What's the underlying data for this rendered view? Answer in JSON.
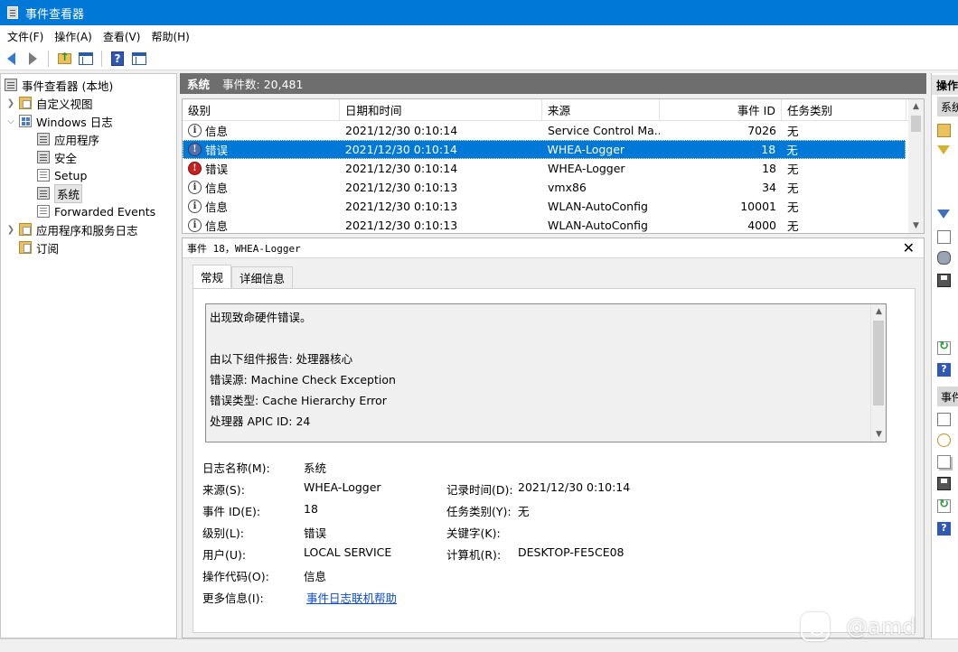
{
  "window": {
    "title": "事件查看器"
  },
  "menu": [
    "文件(F)",
    "操作(A)",
    "查看(V)",
    "帮助(H)"
  ],
  "toolbar": {
    "icons": [
      "back-arrow-icon",
      "forward-arrow-icon",
      "folder-up-icon",
      "show-hide-tree-icon",
      "help-icon",
      "show-hide-action-pane-icon"
    ]
  },
  "tree": {
    "root": "事件查看器 (本地)",
    "custom_views": "自定义视图",
    "windows_logs": "Windows 日志",
    "logs": [
      "应用程序",
      "安全",
      "Setup",
      "系统",
      "Forwarded Events"
    ],
    "app_service_logs": "应用程序和服务日志",
    "subscriptions": "订阅"
  },
  "main_header": {
    "name": "系统",
    "count": "事件数: 20,481"
  },
  "event_table": {
    "columns": [
      "级别",
      "日期和时间",
      "来源",
      "事件 ID",
      "任务类别"
    ],
    "rows": [
      {
        "level": "信息",
        "type": "info",
        "date": "2021/12/30 0:10:14",
        "source": "Service Control Ma...",
        "id": "7026",
        "category": "无"
      },
      {
        "level": "错误",
        "type": "error",
        "date": "2021/12/30 0:10:14",
        "source": "WHEA-Logger",
        "id": "18",
        "category": "无",
        "selected": true
      },
      {
        "level": "错误",
        "type": "error",
        "date": "2021/12/30 0:10:14",
        "source": "WHEA-Logger",
        "id": "18",
        "category": "无"
      },
      {
        "level": "信息",
        "type": "info",
        "date": "2021/12/30 0:10:13",
        "source": "vmx86",
        "id": "34",
        "category": "无"
      },
      {
        "level": "信息",
        "type": "info",
        "date": "2021/12/30 0:10:13",
        "source": "WLAN-AutoConfig",
        "id": "10001",
        "category": "无"
      },
      {
        "level": "信息",
        "type": "info",
        "date": "2021/12/30 0:10:13",
        "source": "WLAN-AutoConfig",
        "id": "4000",
        "category": "无"
      }
    ]
  },
  "detail": {
    "title": "事件 18，WHEA-Logger",
    "tabs": [
      "常规",
      "详细信息"
    ],
    "message": [
      "出现致命硬件错误。",
      "",
      "由以下组件报告: 处理器核心",
      "错误源: Machine Check Exception",
      "错误类型: Cache Hierarchy Error",
      "处理器 APIC ID: 24"
    ],
    "fields": {
      "log_name_label": "日志名称(M):",
      "log_name": "系统",
      "source_label": "来源(S):",
      "source": "WHEA-Logger",
      "logged_label": "记录时间(D):",
      "logged": "2021/12/30 0:10:14",
      "event_id_label": "事件 ID(E):",
      "event_id": "18",
      "task_label": "任务类别(Y):",
      "task": "无",
      "level_label": "级别(L):",
      "level": "错误",
      "keywords_label": "关键字(K):",
      "keywords": "",
      "user_label": "用户(U):",
      "user": "LOCAL SERVICE",
      "computer_label": "计算机(R):",
      "computer": "DESKTOP-FE5CE08",
      "opcode_label": "操作代码(O):",
      "opcode": "信息",
      "more_info_label": "更多信息(I):",
      "more_info_link": "事件日志联机帮助"
    }
  },
  "actions": {
    "header": "操作",
    "section1": "系统",
    "section2": "事件"
  },
  "watermark": {
    "text": "@amd"
  }
}
